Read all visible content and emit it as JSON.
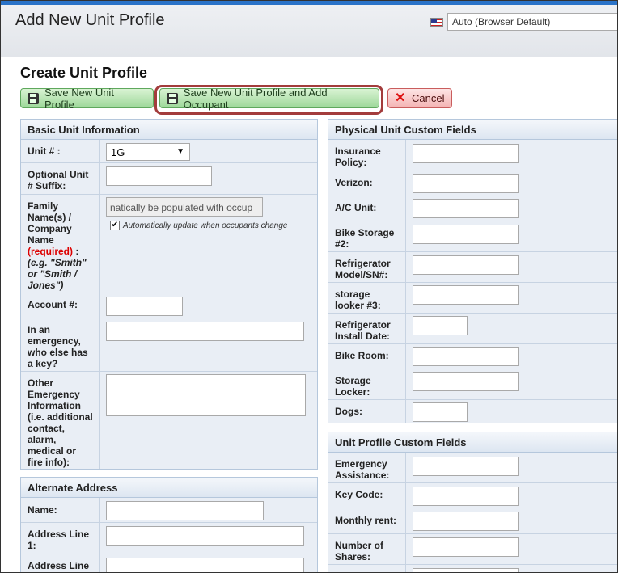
{
  "header": {
    "title": "Add New Unit Profile",
    "language_select": "Auto (Browser Default)",
    "flag_icon": "us-flag-icon"
  },
  "page_title": "Create Unit Profile",
  "toolbar": {
    "save_label": "Save New Unit Profile",
    "save_add_label": "Save New Unit Profile and Add Occupant",
    "cancel_label": "Cancel"
  },
  "basic": {
    "title": "Basic Unit Information",
    "unit_label": "Unit # :",
    "unit_value": "1G",
    "suffix_label_1": "Optional Unit",
    "suffix_label_2": "# Suffix:",
    "family_lines": [
      "Family",
      "Name(s) /",
      "Company",
      "Name"
    ],
    "required": "(required)",
    "colon": " :",
    "example_lines": [
      "(e.g. \"Smith\"",
      "or \"Smith /",
      "Jones\")"
    ],
    "family_value": "natically be populated with occup",
    "auto_update": "Automatically update when occupants change",
    "account_label": "Account #:",
    "emergency_lines": [
      "In an",
      "emergency,",
      "who else has",
      "a key?"
    ],
    "other_lines": [
      "Other",
      "Emergency",
      "Information",
      "(i.e. additional",
      "contact,",
      "alarm,",
      "medical or",
      "fire info):"
    ]
  },
  "alternate": {
    "title": "Alternate Address",
    "name_label": "Name:",
    "addr1_lines": [
      "Address Line",
      "1:"
    ],
    "addr2_label": "Address Line"
  },
  "physical": {
    "title": "Physical Unit Custom Fields",
    "fields": [
      [
        "Insurance",
        "Policy:"
      ],
      [
        "Verizon:"
      ],
      [
        "A/C Unit:"
      ],
      [
        "Bike Storage",
        "#2:"
      ],
      [
        "Refrigerator",
        "Model/SN#:"
      ],
      [
        "storage",
        "looker #3:"
      ],
      [
        "Refrigerator",
        "Install Date:"
      ],
      [
        "Bike Room:"
      ],
      [
        "Storage",
        "Locker:"
      ],
      [
        "Dogs:"
      ]
    ]
  },
  "profile": {
    "title": "Unit Profile Custom Fields",
    "fields": [
      [
        "Emergency",
        "Assistance:"
      ],
      [
        "Key Code:"
      ],
      [
        "Monthly rent:"
      ],
      [
        "Number of",
        "Shares:"
      ]
    ]
  }
}
